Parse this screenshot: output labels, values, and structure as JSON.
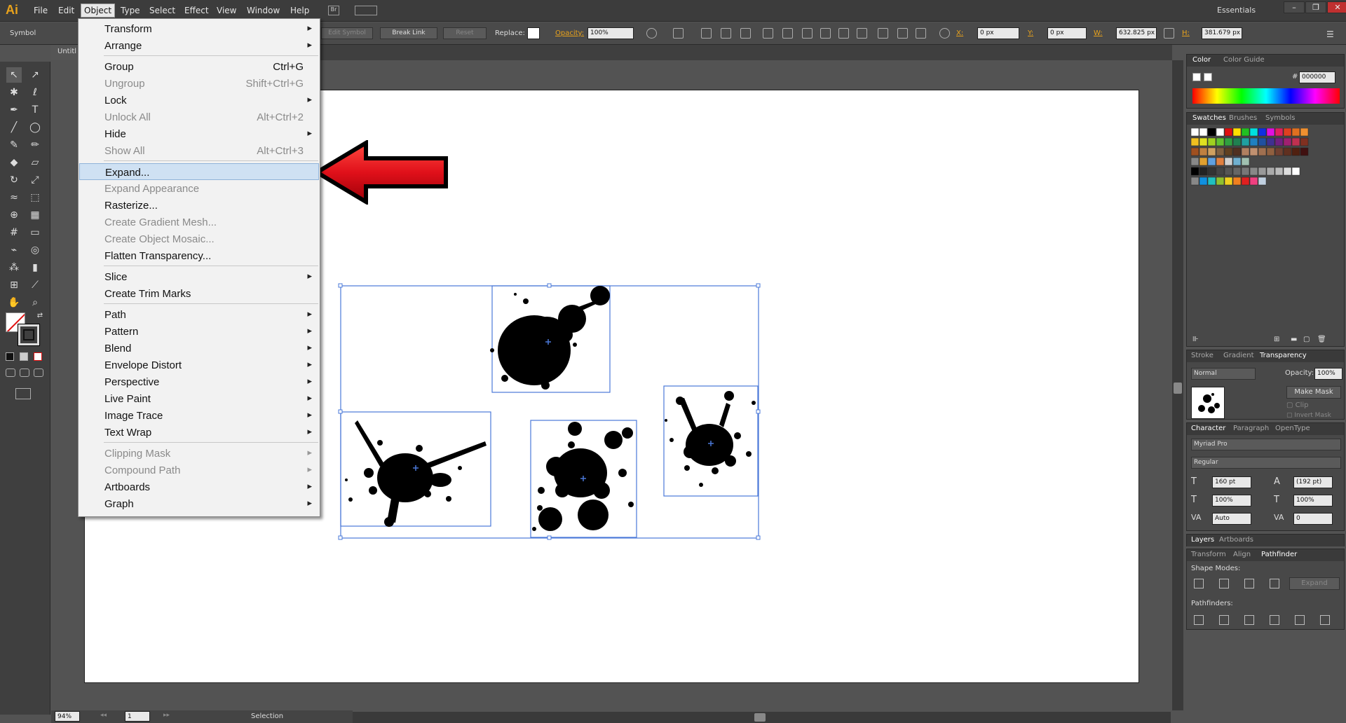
{
  "app": {
    "logo": "Ai",
    "menu": [
      "File",
      "Edit",
      "Object",
      "Type",
      "Select",
      "Effect",
      "View",
      "Window",
      "Help"
    ],
    "workspace": "Essentials",
    "doc_tab": "Untitl"
  },
  "controlbar": {
    "selection_type": "Symbol",
    "edit_symbol": "Edit Symbol",
    "break_link": "Break Link",
    "reset": "Reset",
    "replace_label": "Replace:",
    "opacity_label": "Opacity:",
    "opacity_value": "100%",
    "x_label": "X:",
    "x_value": "0 px",
    "y_label": "Y:",
    "y_value": "0 px",
    "w_label": "W:",
    "w_value": "632.825 px",
    "h_label": "H:",
    "h_value": "381.679 px"
  },
  "object_menu": {
    "items": [
      {
        "label": "Transform",
        "shortcut": "",
        "submenu": true,
        "disabled": false
      },
      {
        "label": "Arrange",
        "shortcut": "",
        "submenu": true,
        "disabled": false
      },
      {
        "label": "Group",
        "shortcut": "Ctrl+G",
        "submenu": false,
        "disabled": false
      },
      {
        "label": "Ungroup",
        "shortcut": "Shift+Ctrl+G",
        "submenu": false,
        "disabled": true
      },
      {
        "label": "Lock",
        "shortcut": "",
        "submenu": true,
        "disabled": false
      },
      {
        "label": "Unlock All",
        "shortcut": "Alt+Ctrl+2",
        "submenu": false,
        "disabled": true
      },
      {
        "label": "Hide",
        "shortcut": "",
        "submenu": true,
        "disabled": false
      },
      {
        "label": "Show All",
        "shortcut": "Alt+Ctrl+3",
        "submenu": false,
        "disabled": true
      },
      {
        "label": "Expand...",
        "shortcut": "",
        "submenu": false,
        "disabled": false,
        "highlighted": true
      },
      {
        "label": "Expand Appearance",
        "shortcut": "",
        "submenu": false,
        "disabled": true
      },
      {
        "label": "Rasterize...",
        "shortcut": "",
        "submenu": false,
        "disabled": false
      },
      {
        "label": "Create Gradient Mesh...",
        "shortcut": "",
        "submenu": false,
        "disabled": true
      },
      {
        "label": "Create Object Mosaic...",
        "shortcut": "",
        "submenu": false,
        "disabled": true
      },
      {
        "label": "Flatten Transparency...",
        "shortcut": "",
        "submenu": false,
        "disabled": false
      },
      {
        "label": "Slice",
        "shortcut": "",
        "submenu": true,
        "disabled": false
      },
      {
        "label": "Create Trim Marks",
        "shortcut": "",
        "submenu": false,
        "disabled": false
      },
      {
        "label": "Path",
        "shortcut": "",
        "submenu": true,
        "disabled": false
      },
      {
        "label": "Pattern",
        "shortcut": "",
        "submenu": true,
        "disabled": false
      },
      {
        "label": "Blend",
        "shortcut": "",
        "submenu": true,
        "disabled": false
      },
      {
        "label": "Envelope Distort",
        "shortcut": "",
        "submenu": true,
        "disabled": false
      },
      {
        "label": "Perspective",
        "shortcut": "",
        "submenu": true,
        "disabled": false
      },
      {
        "label": "Live Paint",
        "shortcut": "",
        "submenu": true,
        "disabled": false
      },
      {
        "label": "Image Trace",
        "shortcut": "",
        "submenu": true,
        "disabled": false
      },
      {
        "label": "Text Wrap",
        "shortcut": "",
        "submenu": true,
        "disabled": false
      },
      {
        "label": "Clipping Mask",
        "shortcut": "",
        "submenu": true,
        "disabled": true
      },
      {
        "label": "Compound Path",
        "shortcut": "",
        "submenu": true,
        "disabled": true
      },
      {
        "label": "Artboards",
        "shortcut": "",
        "submenu": true,
        "disabled": false
      },
      {
        "label": "Graph",
        "shortcut": "",
        "submenu": true,
        "disabled": false
      }
    ]
  },
  "panels": {
    "color_tabs": [
      "Color",
      "Color Guide"
    ],
    "hex_value": "000000",
    "swatch_tabs": [
      "Swatches",
      "Brushes",
      "Symbols"
    ],
    "transparency_tabs": [
      "Stroke",
      "Gradient",
      "Transparency"
    ],
    "blend_mode": "Normal",
    "opacity_label": "Opacity:",
    "opacity_value": "100%",
    "make_mask": "Make Mask",
    "clip": "Clip",
    "invert_mask": "Invert Mask",
    "character_tabs": [
      "Character",
      "Paragraph",
      "OpenType"
    ],
    "font_family": "Myriad Pro",
    "font_style": "Regular",
    "font_size": "160 pt",
    "leading": "(192 pt)",
    "vscale": "100%",
    "hscale": "100%",
    "kerning": "Auto",
    "tracking": "0",
    "layer_tabs": [
      "Layers",
      "Artboards"
    ],
    "pathfinder_tabs": [
      "Transform",
      "Align",
      "Pathfinder"
    ],
    "shape_modes": "Shape Modes:",
    "expand": "Expand",
    "pathfinders": "Pathfinders:"
  },
  "status": {
    "zoom": "94%",
    "artboard_num": "1",
    "tool": "Selection"
  },
  "colors": {
    "accent_highlight": "#cfe1f3",
    "selection": "#4a78d8",
    "arrow": "#e0101a"
  }
}
